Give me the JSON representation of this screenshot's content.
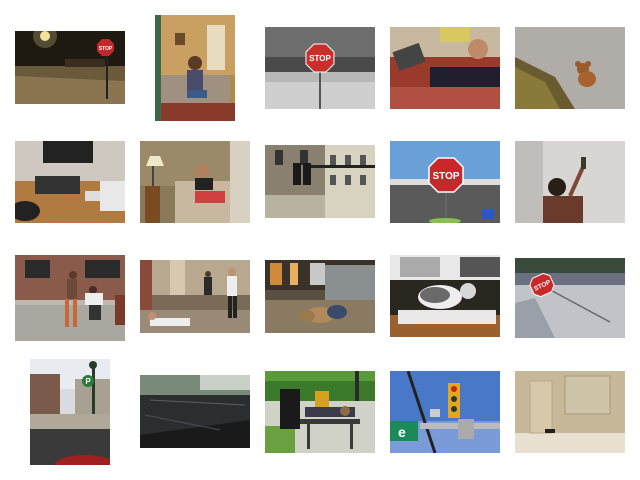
{
  "gallery": {
    "background": "#ffffff",
    "signs": {
      "stop_text": "STOP",
      "parking_letter": "P",
      "street_sign_letter": "e"
    },
    "thumbnails": [
      {
        "name": "night-street-stop-sign"
      },
      {
        "name": "person-on-couch-phone"
      },
      {
        "name": "stop-sign-grayscale"
      },
      {
        "name": "person-lying-with-laptop"
      },
      {
        "name": "teddy-bear-on-grass"
      },
      {
        "name": "cluttered-office-desk"
      },
      {
        "name": "person-in-armchair-laptop"
      },
      {
        "name": "traffic-light-building"
      },
      {
        "name": "stop-sign-parking-lot"
      },
      {
        "name": "person-raising-bottle"
      },
      {
        "name": "people-on-sidewalk"
      },
      {
        "name": "person-lying-in-hallway"
      },
      {
        "name": "teddy-bears-on-floor"
      },
      {
        "name": "cat-on-keyboard"
      },
      {
        "name": "tilted-stop-sign-street"
      },
      {
        "name": "parking-sign-street"
      },
      {
        "name": "car-windshield-view"
      },
      {
        "name": "person-on-bench-park"
      },
      {
        "name": "traffic-light-street-sign"
      },
      {
        "name": "empty-room-door"
      }
    ]
  }
}
